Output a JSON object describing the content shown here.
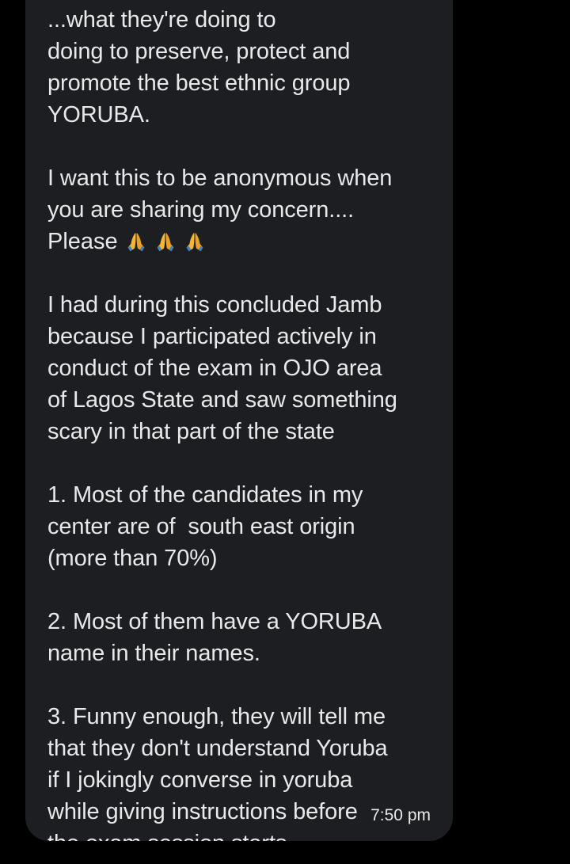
{
  "message": {
    "lines_top": [
      "...what they're doing to",
      "doing to preserve, protect and",
      "promote the best ethnic group",
      "YORUBA."
    ],
    "para2": [
      "I want this to be anonymous when",
      "you are sharing my concern...."
    ],
    "please_label": "Please",
    "emoji_icons": [
      "folded-hands-icon",
      "folded-hands-icon",
      "folded-hands-icon"
    ],
    "para3": [
      "I had during this concluded Jamb",
      "because I participated actively in",
      "conduct of the exam in OJO area",
      "of Lagos State and saw something",
      "scary in that part of the state"
    ],
    "para4": [
      "1. Most of the candidates in my",
      "center are of  south east origin",
      "(more than 70%)"
    ],
    "para5": [
      "2. Most of them have a YORUBA",
      "name in their names."
    ],
    "para6": [
      "3. Funny enough, they will tell me",
      "that they don't understand Yoruba",
      "if I jokingly converse in yoruba",
      "while giving instructions before",
      "the exam session starts"
    ],
    "timestamp": "7:50 pm"
  },
  "colors": {
    "background": "#000000",
    "bubble": "#1c1e21",
    "text": "#e7e9ea",
    "emoji": "#f5b536"
  }
}
